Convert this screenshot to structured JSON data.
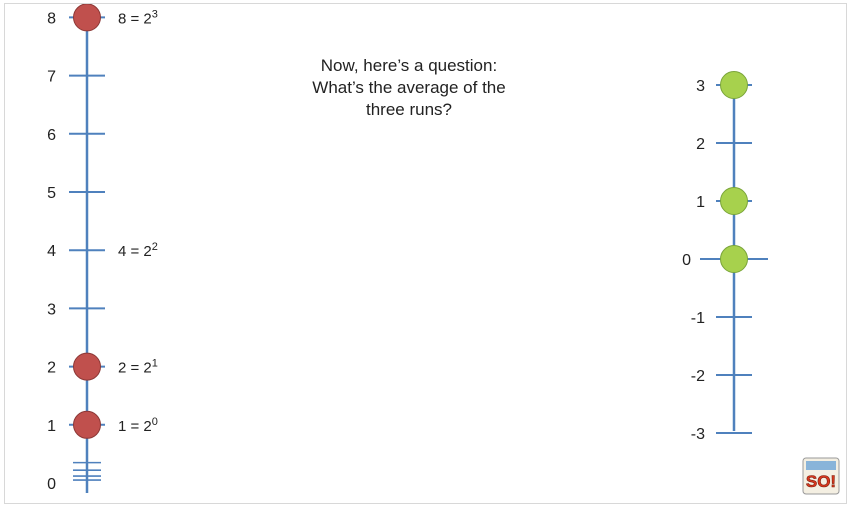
{
  "question": {
    "lines": [
      "Now, here’s a question:",
      "What’s the average of the",
      "three runs?"
    ]
  },
  "left_axis": {
    "ticks": [
      "0",
      "1",
      "2",
      "3",
      "4",
      "5",
      "6",
      "7",
      "8"
    ],
    "points": [
      1,
      2,
      8
    ],
    "annotations": [
      {
        "value": 8,
        "base": "8 = 2",
        "exp": "3"
      },
      {
        "value": 4,
        "base": "4 = 2",
        "exp": "2"
      },
      {
        "value": 2,
        "base": "2 = 2",
        "exp": "1"
      },
      {
        "value": 1,
        "base": "1 = 2",
        "exp": "0"
      }
    ]
  },
  "right_axis": {
    "ticks": [
      "-3",
      "-2",
      "-1",
      "0",
      "1",
      "2",
      "3"
    ],
    "points": [
      0,
      1,
      3
    ]
  },
  "colors": {
    "axis": "#4f81bd",
    "red_point": "#c0504d",
    "green_point": "#a7d14d",
    "text": "#222222"
  },
  "logo": {
    "text": "SO!"
  }
}
